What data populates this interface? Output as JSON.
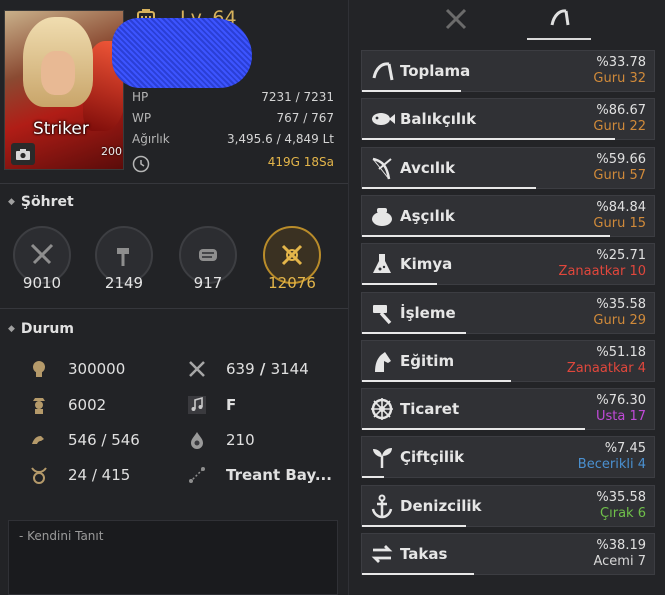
{
  "header": {
    "level": "Lv. 64",
    "character_name": "Striker",
    "class_badge": "200",
    "stats": [
      {
        "label": "HP",
        "value": "7231 / 7231"
      },
      {
        "label": "WP",
        "value": "767 / 767"
      },
      {
        "label": "Ağırlık",
        "value": "3,495.6 / 4,849 Lt"
      }
    ],
    "time_gold": "419",
    "time_g": "G",
    "time_hours": "18",
    "time_sa": "Sa"
  },
  "fame": {
    "title": "Şöhret",
    "items": [
      {
        "icon": "crossed-swords-icon",
        "value": "9010"
      },
      {
        "icon": "hammer-icon",
        "value": "2149"
      },
      {
        "icon": "scroll-icon",
        "value": "917"
      },
      {
        "icon": "combined-fame-icon",
        "value": "12076"
      }
    ]
  },
  "condition": {
    "title": "Durum",
    "items": [
      {
        "icon": "head-icon",
        "value": "300000"
      },
      {
        "icon": "crossed-tools-icon",
        "value_a": "639",
        "sep": " / ",
        "value_b": "3144"
      },
      {
        "icon": "soldier-icon",
        "value": "6002"
      },
      {
        "icon": "music-note-icon",
        "value": "F"
      },
      {
        "icon": "arm-strength-icon",
        "value": "546 / 546"
      },
      {
        "icon": "fire-drop-icon",
        "value": "210"
      },
      {
        "icon": "taurus-icon",
        "value": "24 / 415"
      },
      {
        "icon": "tree-path-icon",
        "value": "Treant Bay..."
      }
    ]
  },
  "intro": {
    "label": "- Kendini Tanıt"
  },
  "tabs": [
    {
      "icon": "crossed-swords-icon",
      "active": false
    },
    {
      "icon": "sickle-icon",
      "active": true
    }
  ],
  "life_skills": [
    {
      "icon": "sickle-icon",
      "name": "Toplama",
      "percent": "%33.78",
      "rank_name": "Guru",
      "rank_level": "32",
      "rank_color": "#d08a3a",
      "progress": 0.3378
    },
    {
      "icon": "fish-icon",
      "name": "Balıkçılık",
      "percent": "%86.67",
      "rank_name": "Guru",
      "rank_level": "22",
      "rank_color": "#d08a3a",
      "progress": 0.8667
    },
    {
      "icon": "bow-icon",
      "name": "Avcılık",
      "percent": "%59.66",
      "rank_name": "Guru",
      "rank_level": "57",
      "rank_color": "#d08a3a",
      "progress": 0.5966
    },
    {
      "icon": "cooking-pot-icon",
      "name": "Aşçılık",
      "percent": "%84.84",
      "rank_name": "Guru",
      "rank_level": "15",
      "rank_color": "#d08a3a",
      "progress": 0.8484
    },
    {
      "icon": "flask-icon",
      "name": "Kimya",
      "percent": "%25.71",
      "rank_name": "Zanaatkar",
      "rank_level": "10",
      "rank_color": "#e0473c",
      "progress": 0.2571
    },
    {
      "icon": "hammer-icon",
      "name": "İşleme",
      "percent": "%35.58",
      "rank_name": "Guru",
      "rank_level": "29",
      "rank_color": "#d08a3a",
      "progress": 0.3558
    },
    {
      "icon": "horse-head-icon",
      "name": "Eğitim",
      "percent": "%51.18",
      "rank_name": "Zanaatkar",
      "rank_level": "4",
      "rank_color": "#e0473c",
      "progress": 0.5118
    },
    {
      "icon": "ship-wheel-icon",
      "name": "Ticaret",
      "percent": "%76.30",
      "rank_name": "Usta",
      "rank_level": "17",
      "rank_color": "#c04ad8",
      "progress": 0.763
    },
    {
      "icon": "sprout-icon",
      "name": "Çiftçilik",
      "percent": "%7.45",
      "rank_name": "Becerikli",
      "rank_level": "4",
      "rank_color": "#4a90d0",
      "progress": 0.0745
    },
    {
      "icon": "anchor-icon",
      "name": "Denizcilik",
      "percent": "%35.58",
      "rank_name": "Çırak",
      "rank_level": "6",
      "rank_color": "#6fc04a",
      "progress": 0.3558
    },
    {
      "icon": "exchange-arrows-icon",
      "name": "Takas",
      "percent": "%38.19",
      "rank_name": "Acemi",
      "rank_level": "7",
      "rank_color": "#d8d8d8",
      "progress": 0.3819
    }
  ]
}
